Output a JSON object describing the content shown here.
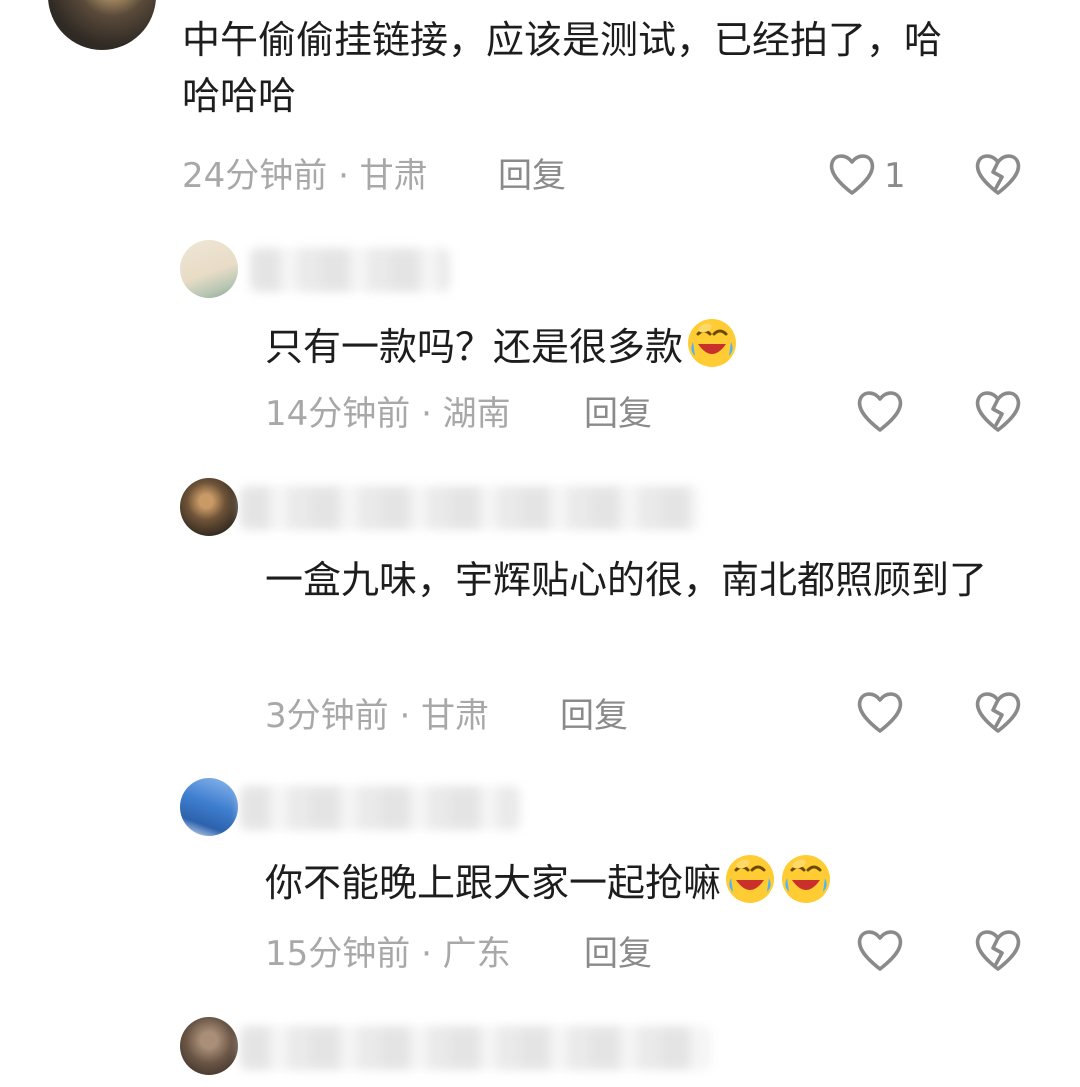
{
  "comments": [
    {
      "text": "中午偷偷挂链接，应该是测试，已经拍了，哈哈哈哈",
      "time_location": "24分钟前 · 甘肃",
      "reply_label": "回复",
      "like_count": "1"
    },
    {
      "text": "只有一款吗？还是很多款",
      "emoji": "laughing-crying-emoji",
      "time_location": "14分钟前 · 湖南",
      "reply_label": "回复"
    },
    {
      "text": "一盒九味，宇辉贴心的很，南北都照顾到了",
      "time_location": "3分钟前 · 甘肃",
      "reply_label": "回复"
    },
    {
      "text": "你不能晚上跟大家一起抢嘛",
      "emoji": "laughing-crying-emoji",
      "time_location": "15分钟前 · 广东",
      "reply_label": "回复"
    }
  ],
  "icons": {
    "like": "heart-outline-icon",
    "dislike": "broken-heart-icon"
  },
  "colors": {
    "text": "#1d1d1d",
    "meta": "#a8a8a8",
    "icon": "#8a8a8a"
  }
}
